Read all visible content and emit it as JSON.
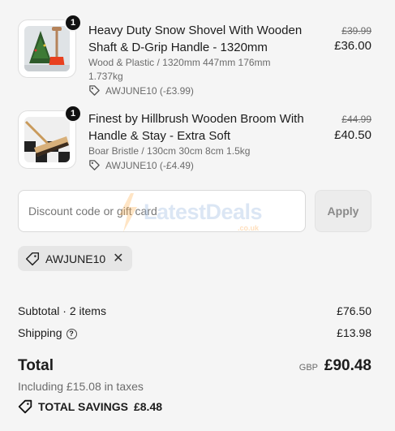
{
  "items": [
    {
      "quantity": "1",
      "name": "Heavy Duty Snow Shovel With Wooden Shaft & D-Grip Handle - 1320mm",
      "details": "Wood & Plastic / 1320mm 447mm 176mm 1.737kg",
      "discount": "AWJUNE10 (-£3.99)",
      "original_price": "£39.99",
      "price": "£36.00",
      "icon": "snow-shovel-thumbnail"
    },
    {
      "quantity": "1",
      "name": "Finest by Hillbrush Wooden Broom With Handle & Stay - Extra Soft",
      "details": "Boar Bristle / 130cm 30cm 8cm 1.5kg",
      "discount": "AWJUNE10 (-£4.49)",
      "original_price": "£44.99",
      "price": "£40.50",
      "icon": "broom-thumbnail"
    }
  ],
  "discount_form": {
    "placeholder": "Discount code or gift card",
    "apply_label": "Apply"
  },
  "watermark": {
    "brand": "LatestDeals",
    "domain": ".co.uk"
  },
  "applied_code": {
    "code": "AWJUNE10"
  },
  "summary": {
    "subtotal_label": "Subtotal · 2 items",
    "subtotal_value": "£76.50",
    "shipping_label": "Shipping",
    "shipping_value": "£13.98",
    "total_label": "Total",
    "currency": "GBP",
    "total_value": "£90.48",
    "taxes_note": "Including £15.08 in taxes",
    "savings_label": "TOTAL SAVINGS",
    "savings_value": "£8.48"
  },
  "colors": {
    "background": "#f5f5f5",
    "text": "#1c1c1c",
    "muted": "#6b6b6b",
    "chip": "#e6e6e6"
  }
}
